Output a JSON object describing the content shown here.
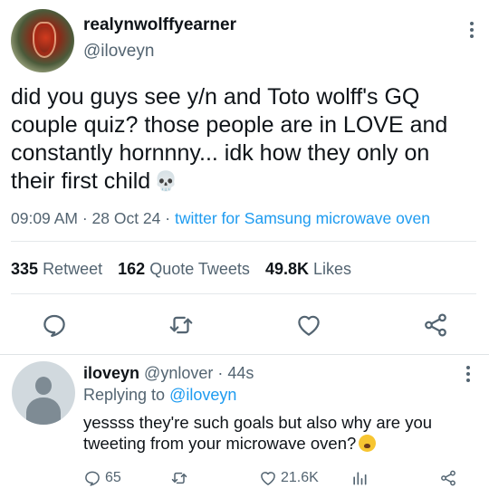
{
  "tweet": {
    "display_name": "realynwolffyearner",
    "handle": "@iloveyn",
    "text": "did you guys see y/n and Toto wolff's GQ couple quiz? those people are in LOVE and constantly hornnny... idk how they only on their first child",
    "emoji": "💀",
    "time": "09:09 AM",
    "date": "28 Oct 24",
    "source": "twitter for Samsung microwave oven",
    "stats": {
      "retweets": "335",
      "retweets_label": "Retweet",
      "quote_tweets": "162",
      "quote_tweets_label": "Quote Tweets",
      "likes": "49.8K",
      "likes_label": "Likes"
    },
    "actions": [
      "reply-icon",
      "retweet-icon",
      "like-icon",
      "share-icon"
    ]
  },
  "reply": {
    "display_name": "iloveyn",
    "handle": "@ynlover",
    "time": "44s",
    "replying_prefix": "Replying to",
    "replying_to": "@iloveyn",
    "text": "yessss they're such goals but also why are you tweeting from your microwave oven?",
    "reply_count": "65",
    "like_count": "21.6K"
  },
  "colors": {
    "accent": "#1d9bf0",
    "secondary_text": "#536471",
    "primary_text": "#0f1419"
  }
}
